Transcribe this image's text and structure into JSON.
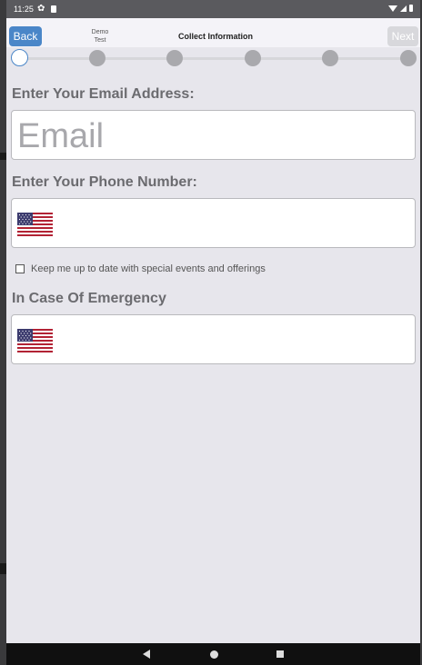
{
  "status_bar": {
    "time": "11:25",
    "icons": [
      "gear-icon",
      "sd-card-icon",
      "wifi-icon",
      "signal-icon",
      "battery-icon"
    ]
  },
  "header": {
    "back_label": "Back",
    "demo_line1": "Demo",
    "demo_line2": "Test",
    "title": "Collect Information",
    "next_label": "Next"
  },
  "stepper": {
    "total_steps": 6,
    "current_step": 1
  },
  "form": {
    "email": {
      "label": "Enter Your Email Address:",
      "placeholder": "Email",
      "value": ""
    },
    "phone": {
      "label": "Enter Your Phone Number:",
      "country_flag": "us-flag-icon",
      "value": ""
    },
    "opt_in": {
      "label": "Keep me up to date with special events and offerings",
      "checked": false
    },
    "emergency": {
      "label": "In Case Of Emergency",
      "country_flag": "us-flag-icon",
      "value": ""
    }
  },
  "colors": {
    "accent": "#4a86c8",
    "background": "#e7e6ec",
    "label": "#6b6b6f"
  }
}
